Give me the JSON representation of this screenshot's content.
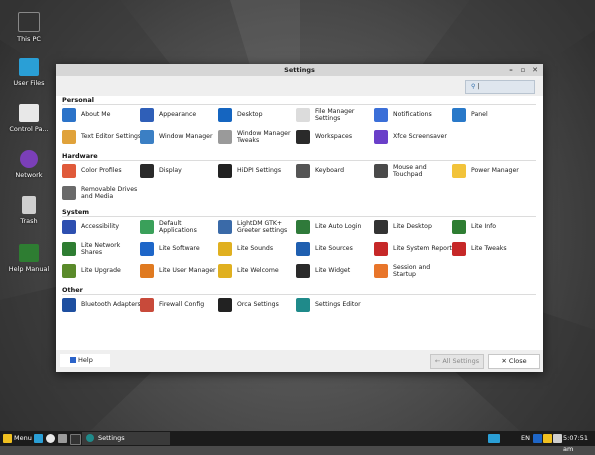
{
  "desktop": {
    "icons": [
      {
        "label": "This PC",
        "icon": "monitor-icon"
      },
      {
        "label": "User Files",
        "icon": "home-folder-icon"
      },
      {
        "label": "Control Pa...",
        "icon": "control-panel-icon"
      },
      {
        "label": "Network",
        "icon": "network-icon"
      },
      {
        "label": "Trash",
        "icon": "trash-icon"
      },
      {
        "label": "Help Manual",
        "icon": "help-manual-icon"
      }
    ]
  },
  "window": {
    "title": "Settings",
    "search": {
      "value": "",
      "icon": "search-icon"
    },
    "sections": [
      {
        "title": "Personal",
        "items": [
          {
            "label": "About Me",
            "icon": "person-icon",
            "color": "#2b73c9"
          },
          {
            "label": "Appearance",
            "icon": "appearance-icon",
            "color": "#2f5fb8"
          },
          {
            "label": "Desktop",
            "icon": "desktop-icon",
            "color": "#1565c0"
          },
          {
            "label": "File Manager Settings",
            "icon": "file-manager-icon",
            "color": "#dcdcdc"
          },
          {
            "label": "Notifications",
            "icon": "notifications-icon",
            "color": "#3b6fd8"
          },
          {
            "label": "Panel",
            "icon": "panel-icon",
            "color": "#2979c9"
          },
          {
            "label": "Text Editor Settings",
            "icon": "text-editor-icon",
            "color": "#e0a23a"
          },
          {
            "label": "Window Manager",
            "icon": "window-manager-icon",
            "color": "#3b7fc4"
          },
          {
            "label": "Window Manager Tweaks",
            "icon": "window-tweaks-icon",
            "color": "#9a9a9a"
          },
          {
            "label": "Workspaces",
            "icon": "workspaces-icon",
            "color": "#2a2a2a"
          },
          {
            "label": "Xfce Screensaver",
            "icon": "screensaver-icon",
            "color": "#6a3fc9"
          }
        ]
      },
      {
        "title": "Hardware",
        "items": [
          {
            "label": "Color Profiles",
            "icon": "color-profiles-icon",
            "color": "#e05a3a"
          },
          {
            "label": "Display",
            "icon": "display-icon",
            "color": "#2a2a2a"
          },
          {
            "label": "HiDPI Settings",
            "icon": "hidpi-icon",
            "color": "#222222"
          },
          {
            "label": "Keyboard",
            "icon": "keyboard-icon",
            "color": "#555555"
          },
          {
            "label": "Mouse and Touchpad",
            "icon": "mouse-icon",
            "color": "#4a4a4a"
          },
          {
            "label": "Power Manager",
            "icon": "power-icon",
            "color": "#f2c33a"
          },
          {
            "label": "Removable Drives and Media",
            "icon": "removable-drive-icon",
            "color": "#6a6a6a"
          }
        ]
      },
      {
        "title": "System",
        "items": [
          {
            "label": "Accessibility",
            "icon": "accessibility-icon",
            "color": "#2d4fb0"
          },
          {
            "label": "Default Applications",
            "icon": "default-apps-icon",
            "color": "#3aa05a"
          },
          {
            "label": "LightDM GTK+ Greeter settings",
            "icon": "lightdm-icon",
            "color": "#3a6aa8"
          },
          {
            "label": "Lite Auto Login",
            "icon": "auto-login-icon",
            "color": "#2f7a3a"
          },
          {
            "label": "Lite Desktop",
            "icon": "lite-desktop-icon",
            "color": "#333333"
          },
          {
            "label": "Lite Info",
            "icon": "lite-info-icon",
            "color": "#2e7d32"
          },
          {
            "label": "Lite Network Shares",
            "icon": "network-shares-icon",
            "color": "#2e7d32"
          },
          {
            "label": "Lite Software",
            "icon": "software-icon",
            "color": "#1e66c8"
          },
          {
            "label": "Lite Sounds",
            "icon": "sounds-icon",
            "color": "#e0b020"
          },
          {
            "label": "Lite Sources",
            "icon": "sources-icon",
            "color": "#1f5fb0"
          },
          {
            "label": "Lite System Report",
            "icon": "system-report-icon",
            "color": "#c62828"
          },
          {
            "label": "Lite Tweaks",
            "icon": "tweaks-icon",
            "color": "#c62828"
          },
          {
            "label": "Lite Upgrade",
            "icon": "upgrade-icon",
            "color": "#5a8a2a"
          },
          {
            "label": "Lite User Manager",
            "icon": "user-manager-icon",
            "color": "#e07a20"
          },
          {
            "label": "Lite Welcome",
            "icon": "welcome-icon",
            "color": "#e0b020"
          },
          {
            "label": "Lite Widget",
            "icon": "widget-icon",
            "color": "#2a2a2a"
          },
          {
            "label": "Session and Startup",
            "icon": "session-icon",
            "color": "#e8752a"
          }
        ]
      },
      {
        "title": "Other",
        "items": [
          {
            "label": "Bluetooth Adapters",
            "icon": "bluetooth-icon",
            "color": "#1e4fa0"
          },
          {
            "label": "Firewall Config",
            "icon": "firewall-icon",
            "color": "#c84a3a"
          },
          {
            "label": "Orca Settings",
            "icon": "orca-icon",
            "color": "#222222"
          },
          {
            "label": "Settings Editor",
            "icon": "settings-editor-icon",
            "color": "#1f8a8a"
          }
        ]
      }
    ],
    "footer": {
      "help": "Help",
      "all_settings": "All Settings",
      "close": "Close"
    }
  },
  "taskbar": {
    "menu": "Menu",
    "task": "Settings",
    "lang": "EN",
    "clock": "5:07:51 am"
  }
}
